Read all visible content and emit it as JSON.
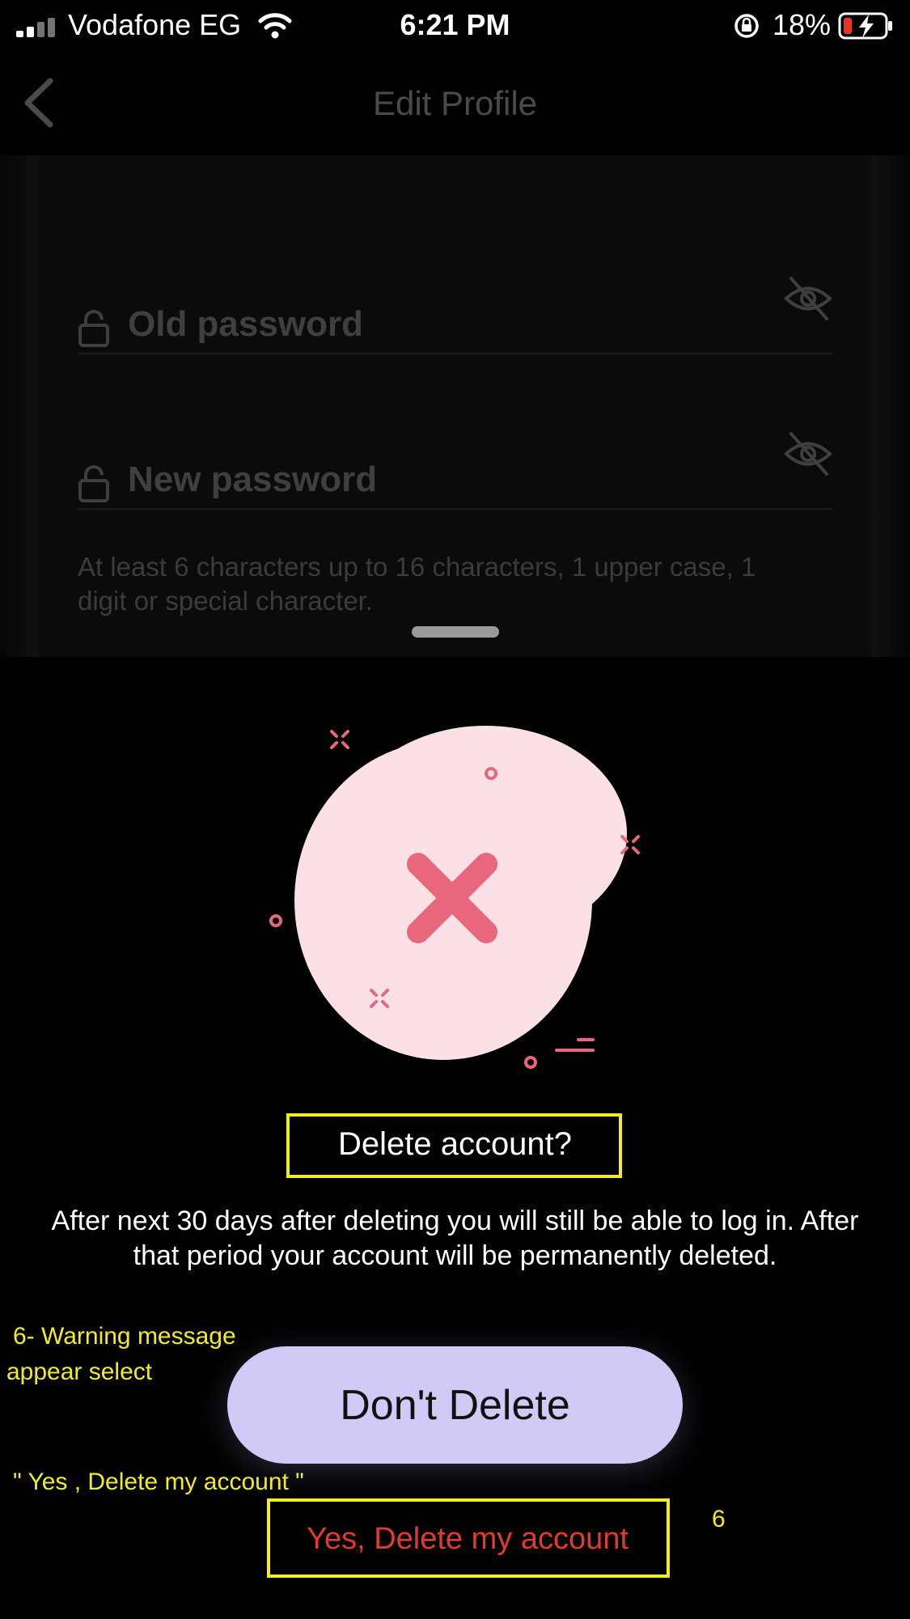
{
  "status_bar": {
    "carrier": "Vodafone EG",
    "time": "6:21 PM",
    "battery_percent": "18%",
    "icons": [
      "signal-icon",
      "wifi-icon",
      "rotation-lock-icon",
      "battery-charging-icon"
    ]
  },
  "header": {
    "title": "Edit Profile",
    "back_icon": "chevron-left-icon"
  },
  "form": {
    "old_password_placeholder": "Old password",
    "new_password_placeholder": "New password",
    "hint": "At least 6 characters up to 16 characters, 1 upper case, 1 digit or special character."
  },
  "sheet": {
    "illustration_icon": "x-mark-icon",
    "title": "Delete account?",
    "message": "After next 30 days after deleting you will still be able to log in. After that period your account will be permanently deleted.",
    "dont_delete_label": "Don't Delete",
    "yes_delete_label": "Yes, Delete my account"
  },
  "annotations": {
    "note_line1": "6- Warning message",
    "note_line2": "appear select",
    "note_line3": "\" Yes , Delete my account \"",
    "step_number": "6"
  },
  "colors": {
    "accent_button": "#d2c9f6",
    "danger_text": "#e23b2e",
    "annotation": "#f2ec23",
    "illustration_fill": "#fbe1e6",
    "illustration_mark": "#e8677d"
  }
}
